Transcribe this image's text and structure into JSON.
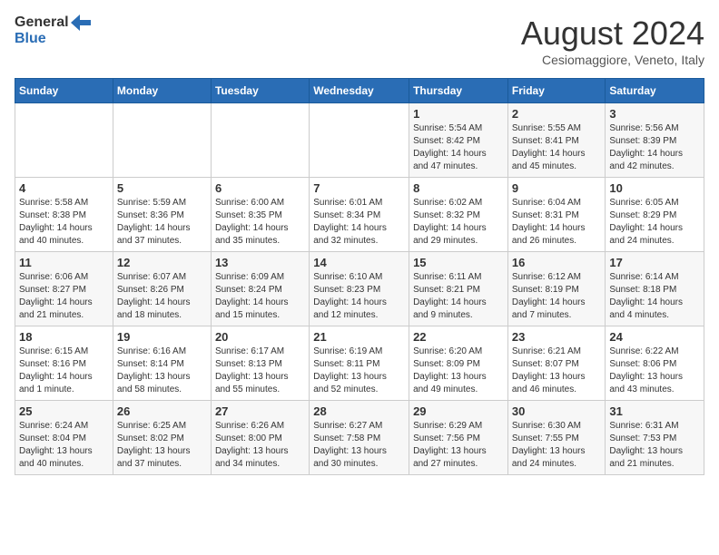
{
  "logo": {
    "line1": "General",
    "line2": "Blue"
  },
  "title": "August 2024",
  "subtitle": "Cesiomaggiore, Veneto, Italy",
  "days_header": [
    "Sunday",
    "Monday",
    "Tuesday",
    "Wednesday",
    "Thursday",
    "Friday",
    "Saturday"
  ],
  "weeks": [
    [
      {
        "day": "",
        "info": ""
      },
      {
        "day": "",
        "info": ""
      },
      {
        "day": "",
        "info": ""
      },
      {
        "day": "",
        "info": ""
      },
      {
        "day": "1",
        "info": "Sunrise: 5:54 AM\nSunset: 8:42 PM\nDaylight: 14 hours\nand 47 minutes."
      },
      {
        "day": "2",
        "info": "Sunrise: 5:55 AM\nSunset: 8:41 PM\nDaylight: 14 hours\nand 45 minutes."
      },
      {
        "day": "3",
        "info": "Sunrise: 5:56 AM\nSunset: 8:39 PM\nDaylight: 14 hours\nand 42 minutes."
      }
    ],
    [
      {
        "day": "4",
        "info": "Sunrise: 5:58 AM\nSunset: 8:38 PM\nDaylight: 14 hours\nand 40 minutes."
      },
      {
        "day": "5",
        "info": "Sunrise: 5:59 AM\nSunset: 8:36 PM\nDaylight: 14 hours\nand 37 minutes."
      },
      {
        "day": "6",
        "info": "Sunrise: 6:00 AM\nSunset: 8:35 PM\nDaylight: 14 hours\nand 35 minutes."
      },
      {
        "day": "7",
        "info": "Sunrise: 6:01 AM\nSunset: 8:34 PM\nDaylight: 14 hours\nand 32 minutes."
      },
      {
        "day": "8",
        "info": "Sunrise: 6:02 AM\nSunset: 8:32 PM\nDaylight: 14 hours\nand 29 minutes."
      },
      {
        "day": "9",
        "info": "Sunrise: 6:04 AM\nSunset: 8:31 PM\nDaylight: 14 hours\nand 26 minutes."
      },
      {
        "day": "10",
        "info": "Sunrise: 6:05 AM\nSunset: 8:29 PM\nDaylight: 14 hours\nand 24 minutes."
      }
    ],
    [
      {
        "day": "11",
        "info": "Sunrise: 6:06 AM\nSunset: 8:27 PM\nDaylight: 14 hours\nand 21 minutes."
      },
      {
        "day": "12",
        "info": "Sunrise: 6:07 AM\nSunset: 8:26 PM\nDaylight: 14 hours\nand 18 minutes."
      },
      {
        "day": "13",
        "info": "Sunrise: 6:09 AM\nSunset: 8:24 PM\nDaylight: 14 hours\nand 15 minutes."
      },
      {
        "day": "14",
        "info": "Sunrise: 6:10 AM\nSunset: 8:23 PM\nDaylight: 14 hours\nand 12 minutes."
      },
      {
        "day": "15",
        "info": "Sunrise: 6:11 AM\nSunset: 8:21 PM\nDaylight: 14 hours\nand 9 minutes."
      },
      {
        "day": "16",
        "info": "Sunrise: 6:12 AM\nSunset: 8:19 PM\nDaylight: 14 hours\nand 7 minutes."
      },
      {
        "day": "17",
        "info": "Sunrise: 6:14 AM\nSunset: 8:18 PM\nDaylight: 14 hours\nand 4 minutes."
      }
    ],
    [
      {
        "day": "18",
        "info": "Sunrise: 6:15 AM\nSunset: 8:16 PM\nDaylight: 14 hours\nand 1 minute."
      },
      {
        "day": "19",
        "info": "Sunrise: 6:16 AM\nSunset: 8:14 PM\nDaylight: 13 hours\nand 58 minutes."
      },
      {
        "day": "20",
        "info": "Sunrise: 6:17 AM\nSunset: 8:13 PM\nDaylight: 13 hours\nand 55 minutes."
      },
      {
        "day": "21",
        "info": "Sunrise: 6:19 AM\nSunset: 8:11 PM\nDaylight: 13 hours\nand 52 minutes."
      },
      {
        "day": "22",
        "info": "Sunrise: 6:20 AM\nSunset: 8:09 PM\nDaylight: 13 hours\nand 49 minutes."
      },
      {
        "day": "23",
        "info": "Sunrise: 6:21 AM\nSunset: 8:07 PM\nDaylight: 13 hours\nand 46 minutes."
      },
      {
        "day": "24",
        "info": "Sunrise: 6:22 AM\nSunset: 8:06 PM\nDaylight: 13 hours\nand 43 minutes."
      }
    ],
    [
      {
        "day": "25",
        "info": "Sunrise: 6:24 AM\nSunset: 8:04 PM\nDaylight: 13 hours\nand 40 minutes."
      },
      {
        "day": "26",
        "info": "Sunrise: 6:25 AM\nSunset: 8:02 PM\nDaylight: 13 hours\nand 37 minutes."
      },
      {
        "day": "27",
        "info": "Sunrise: 6:26 AM\nSunset: 8:00 PM\nDaylight: 13 hours\nand 34 minutes."
      },
      {
        "day": "28",
        "info": "Sunrise: 6:27 AM\nSunset: 7:58 PM\nDaylight: 13 hours\nand 30 minutes."
      },
      {
        "day": "29",
        "info": "Sunrise: 6:29 AM\nSunset: 7:56 PM\nDaylight: 13 hours\nand 27 minutes."
      },
      {
        "day": "30",
        "info": "Sunrise: 6:30 AM\nSunset: 7:55 PM\nDaylight: 13 hours\nand 24 minutes."
      },
      {
        "day": "31",
        "info": "Sunrise: 6:31 AM\nSunset: 7:53 PM\nDaylight: 13 hours\nand 21 minutes."
      }
    ]
  ]
}
